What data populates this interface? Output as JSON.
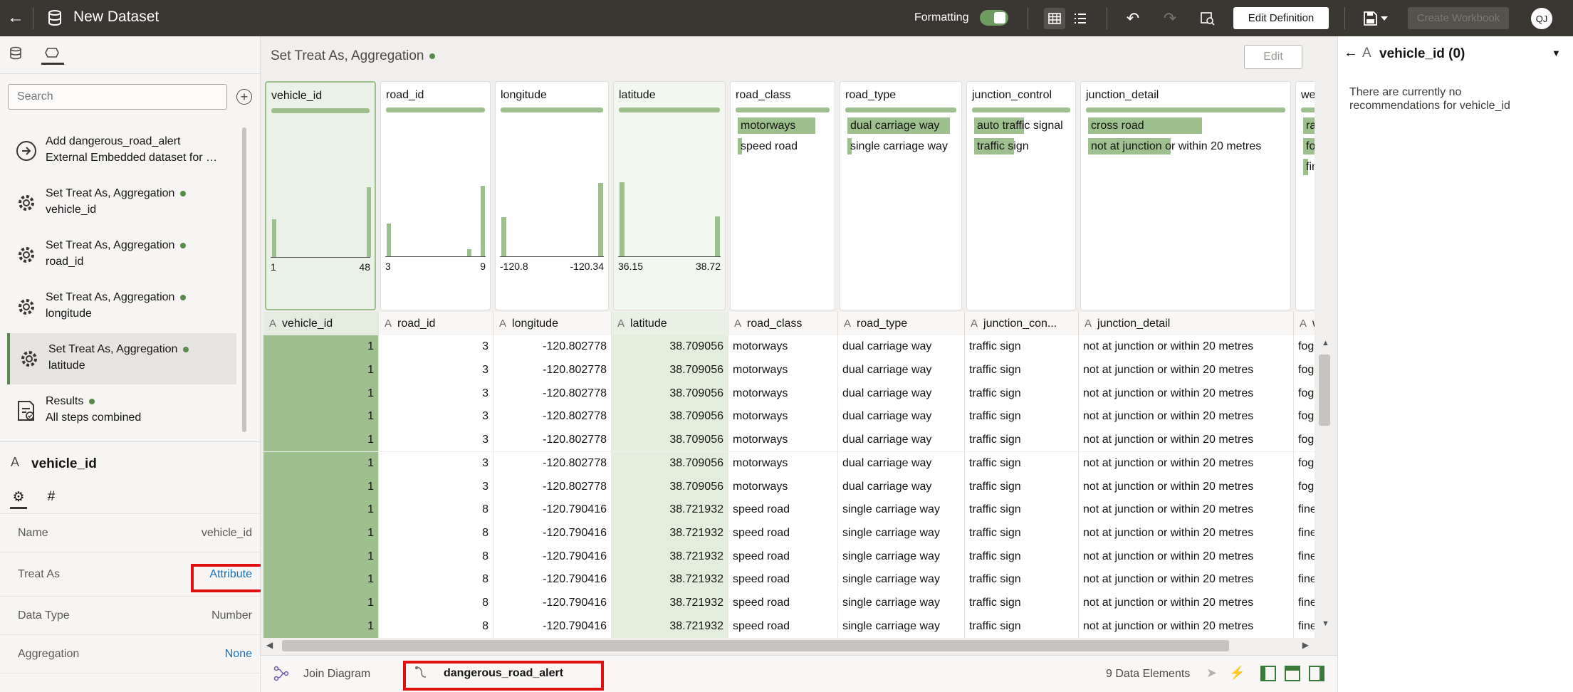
{
  "topbar": {
    "title": "New Dataset",
    "formatting_label": "Formatting",
    "edit_definition": "Edit Definition",
    "create_workbook": "Create Workbook",
    "avatar": "QJ",
    "colors": {
      "bar": "#3a3632",
      "toggle": "#6e9b62"
    }
  },
  "left": {
    "search_placeholder": "Search",
    "steps": [
      {
        "line1": "Add dangerous_road_alert",
        "line2": "External Embedded dataset for …",
        "icon": "arrow-circle-icon"
      },
      {
        "line1": "Set Treat As, Aggregation",
        "line2": "vehicle_id",
        "icon": "gear-icon"
      },
      {
        "line1": "Set Treat As, Aggregation",
        "line2": "road_id",
        "icon": "gear-icon"
      },
      {
        "line1": "Set Treat As, Aggregation",
        "line2": "longitude",
        "icon": "gear-icon"
      },
      {
        "line1": "Set Treat As, Aggregation",
        "line2": "latitude",
        "icon": "gear-icon"
      },
      {
        "line1": "Results",
        "line2": "All steps combined",
        "icon": "results-icon"
      }
    ],
    "column": {
      "type_glyph": "A",
      "name": "vehicle_id",
      "props": [
        {
          "label": "Name",
          "value": "vehicle_id"
        },
        {
          "label": "Treat As",
          "value": "Attribute"
        },
        {
          "label": "Data Type",
          "value": "Number"
        },
        {
          "label": "Aggregation",
          "value": "None"
        }
      ]
    }
  },
  "center": {
    "step_title": "Set Treat As, Aggregation",
    "edit_label": "Edit",
    "columns": [
      {
        "name": "vehicle_id",
        "header": "vehicle_id",
        "kind": "num",
        "min": "1",
        "max": "48",
        "bars": [
          0.41,
          0,
          0,
          0,
          0,
          0,
          0,
          0,
          0,
          0,
          0,
          0,
          0,
          0,
          0.75
        ]
      },
      {
        "name": "road_id",
        "header": "road_id",
        "kind": "num",
        "min": "3",
        "max": "9",
        "bars": [
          0.35,
          0,
          0,
          0,
          0,
          0,
          0,
          0,
          0,
          0,
          0,
          0,
          0.08,
          0,
          0.76
        ]
      },
      {
        "name": "longitude",
        "header": "longitude",
        "kind": "num",
        "min": "-120.8",
        "max": "-120.34",
        "bars": [
          0.42,
          0,
          0,
          0,
          0,
          0,
          0,
          0,
          0,
          0,
          0,
          0,
          0,
          0,
          0.79
        ]
      },
      {
        "name": "latitude",
        "header": "latitude",
        "kind": "num",
        "min": "36.15",
        "max": "38.72",
        "bars": [
          0.8,
          0,
          0,
          0,
          0,
          0,
          0,
          0,
          0,
          0,
          0,
          0,
          0,
          0,
          0.43
        ]
      },
      {
        "name": "road_class",
        "header": "road_class",
        "kind": "cat",
        "cats": [
          {
            "label": "motorways",
            "frac": 0.85
          },
          {
            "label": "speed road",
            "frac": 0.04
          }
        ]
      },
      {
        "name": "road_type",
        "header": "road_type",
        "kind": "cat",
        "cats": [
          {
            "label": "dual carriage way",
            "frac": 0.95
          },
          {
            "label": "single carriage way",
            "frac": 0.04
          }
        ]
      },
      {
        "name": "junction_control",
        "header": "junction_con...",
        "kind": "cat",
        "cats": [
          {
            "label": "auto traffic signal",
            "frac": 0.52
          },
          {
            "label": "traffic sign",
            "frac": 0.42
          }
        ]
      },
      {
        "name": "junction_detail",
        "header": "junction_detail",
        "kind": "cat",
        "cats": [
          {
            "label": "cross road",
            "frac": 0.58
          },
          {
            "label": "not at junction or within 20 metres",
            "frac": 0.42
          }
        ]
      },
      {
        "name": "wea",
        "header": "w",
        "kind": "cat",
        "cats": [
          {
            "label": "rai",
            "frac": 0.9
          },
          {
            "label": "fog",
            "frac": 0.6
          },
          {
            "label": "fine",
            "frac": 0.2
          }
        ]
      }
    ],
    "rows": [
      [
        "1",
        "3",
        "-120.802778",
        "38.709056",
        "motorways",
        "dual carriage way",
        "traffic sign",
        "not at junction or within 20 metres",
        "fog"
      ],
      [
        "1",
        "3",
        "-120.802778",
        "38.709056",
        "motorways",
        "dual carriage way",
        "traffic sign",
        "not at junction or within 20 metres",
        "fog"
      ],
      [
        "1",
        "3",
        "-120.802778",
        "38.709056",
        "motorways",
        "dual carriage way",
        "traffic sign",
        "not at junction or within 20 metres",
        "fog"
      ],
      [
        "1",
        "3",
        "-120.802778",
        "38.709056",
        "motorways",
        "dual carriage way",
        "traffic sign",
        "not at junction or within 20 metres",
        "fog"
      ],
      [
        "1",
        "3",
        "-120.802778",
        "38.709056",
        "motorways",
        "dual carriage way",
        "traffic sign",
        "not at junction or within 20 metres",
        "fog"
      ],
      [
        "1",
        "3",
        "-120.802778",
        "38.709056",
        "motorways",
        "dual carriage way",
        "traffic sign",
        "not at junction or within 20 metres",
        "fog"
      ],
      [
        "1",
        "3",
        "-120.802778",
        "38.709056",
        "motorways",
        "dual carriage way",
        "traffic sign",
        "not at junction or within 20 metres",
        "fog"
      ],
      [
        "1",
        "8",
        "-120.790416",
        "38.721932",
        "speed road",
        "single carriage way",
        "traffic sign",
        "not at junction or within 20 metres",
        "fine"
      ],
      [
        "1",
        "8",
        "-120.790416",
        "38.721932",
        "speed road",
        "single carriage way",
        "traffic sign",
        "not at junction or within 20 metres",
        "fine"
      ],
      [
        "1",
        "8",
        "-120.790416",
        "38.721932",
        "speed road",
        "single carriage way",
        "traffic sign",
        "not at junction or within 20 metres",
        "fine"
      ],
      [
        "1",
        "8",
        "-120.790416",
        "38.721932",
        "speed road",
        "single carriage way",
        "traffic sign",
        "not at junction or within 20 metres",
        "fine"
      ],
      [
        "1",
        "8",
        "-120.790416",
        "38.721932",
        "speed road",
        "single carriage way",
        "traffic sign",
        "not at junction or within 20 metres",
        "fine"
      ],
      [
        "1",
        "8",
        "-120.790416",
        "38.721932",
        "speed road",
        "single carriage way",
        "traffic sign",
        "not at junction or within 20 metres",
        "fine"
      ]
    ],
    "bottom": {
      "join_diagram": "Join Diagram",
      "dataset_tab": "dangerous_road_alert",
      "elements": "9 Data Elements"
    }
  },
  "right": {
    "type_glyph": "A",
    "title": "vehicle_id (0)",
    "message": "There are currently no recommendations for vehicle_id"
  }
}
